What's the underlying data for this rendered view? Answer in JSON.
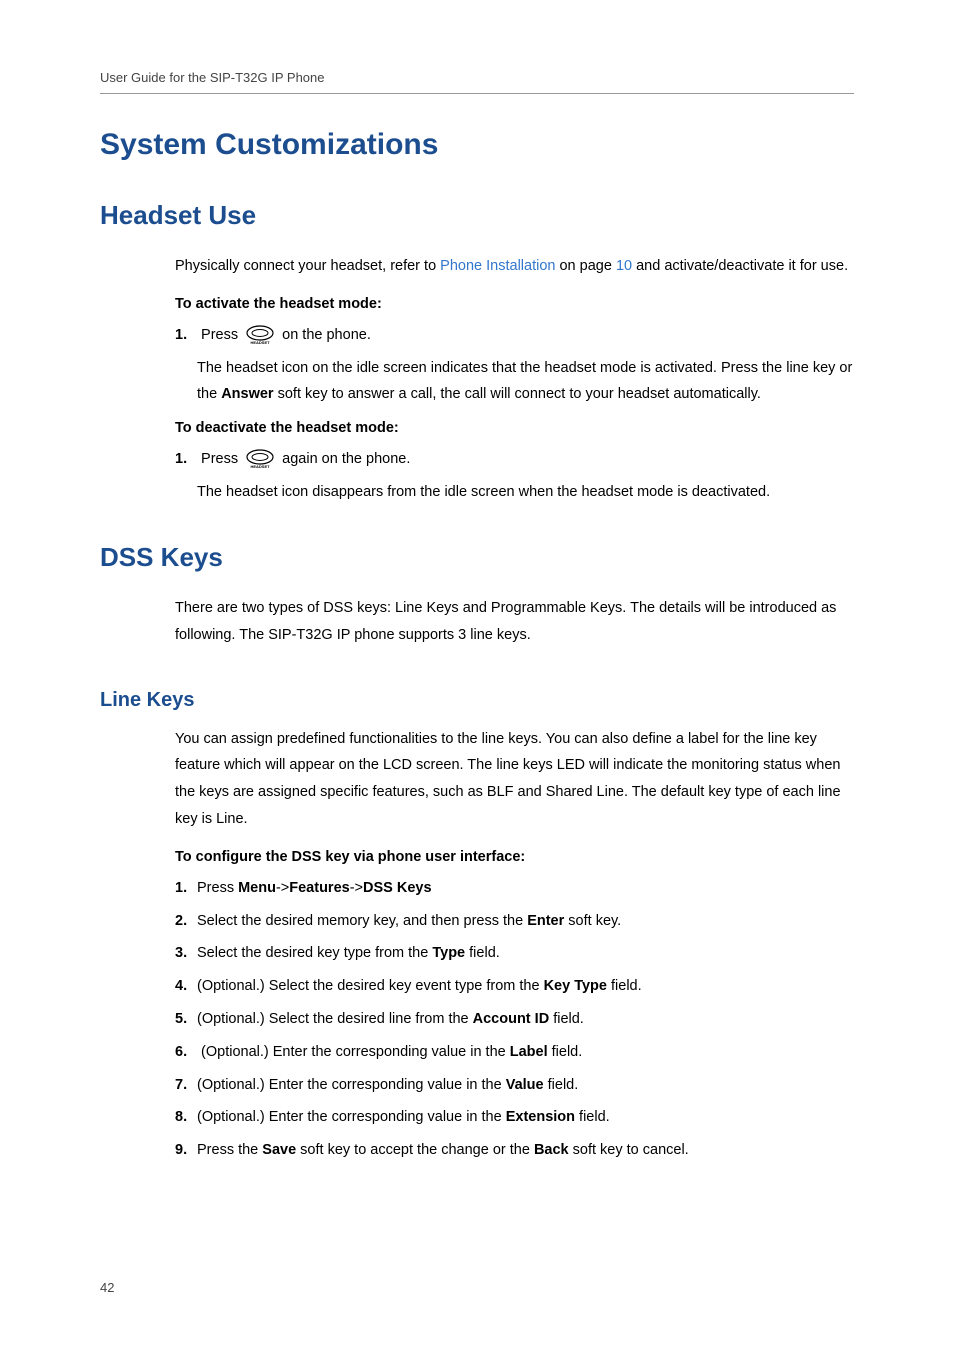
{
  "header": "User Guide for the SIP-T32G IP Phone",
  "pageNumber": "42",
  "h1": "System Customizations",
  "h2_headset": "Headset Use",
  "headset_intro_p1": "Physically connect your headset, refer to ",
  "headset_intro_link": "Phone Installation",
  "headset_intro_p2": " on page ",
  "headset_intro_page": "10",
  "headset_intro_p3": " and activate/deactivate it for use.",
  "activate_subhead": "To activate the headset mode:",
  "activate_step1_num": "1.",
  "activate_step1_a": "Press ",
  "activate_step1_b": " on the phone.",
  "activate_result_a": "The headset icon on the idle screen indicates that the headset mode is activated. Press the line key or the ",
  "activate_result_bold": "Answer",
  "activate_result_b": " soft key to answer a call, the call will connect to your headset automatically.",
  "deactivate_subhead": "To deactivate the headset mode:",
  "deactivate_step1_num": "1.",
  "deactivate_step1_a": "Press ",
  "deactivate_step1_b": " again on the phone.",
  "deactivate_result": "The headset icon disappears from the idle screen when the headset mode is deactivated.",
  "h2_dss": "DSS Keys",
  "dss_intro": "There are two types of DSS keys: Line Keys and Programmable Keys. The details will be introduced as following. The SIP-T32G IP phone supports 3 line keys.",
  "h3_linekeys": "Line Keys",
  "linekeys_intro": "You can assign predefined functionalities to the line keys. You can also define a label for the line key feature which will appear on the LCD screen. The line keys LED will indicate the monitoring status when the keys are assigned specific features, such as BLF and Shared Line. The default key type of each line key is Line.",
  "configure_subhead": "To configure the DSS key via phone user interface:",
  "steps": [
    {
      "num": "1.",
      "parts": [
        {
          "b": 0,
          "t": "Press "
        },
        {
          "b": 1,
          "t": "Menu"
        },
        {
          "b": 0,
          "t": "->"
        },
        {
          "b": 1,
          "t": "Features"
        },
        {
          "b": 0,
          "t": "->"
        },
        {
          "b": 1,
          "t": "DSS Keys"
        }
      ]
    },
    {
      "num": "2.",
      "parts": [
        {
          "b": 0,
          "t": "Select the desired memory key, and then press the "
        },
        {
          "b": 1,
          "t": "Enter"
        },
        {
          "b": 0,
          "t": " soft key."
        }
      ]
    },
    {
      "num": "3.",
      "parts": [
        {
          "b": 0,
          "t": "Select the desired key type from the "
        },
        {
          "b": 1,
          "t": "Type"
        },
        {
          "b": 0,
          "t": " field."
        }
      ]
    },
    {
      "num": "4.",
      "parts": [
        {
          "b": 0,
          "t": "(Optional.) Select the desired key event type from the "
        },
        {
          "b": 1,
          "t": "Key Type"
        },
        {
          "b": 0,
          "t": " field."
        }
      ]
    },
    {
      "num": "5.",
      "parts": [
        {
          "b": 0,
          "t": "(Optional.) Select the desired line from the "
        },
        {
          "b": 1,
          "t": "Account ID"
        },
        {
          "b": 0,
          "t": " field."
        }
      ]
    },
    {
      "num": "6.",
      "parts": [
        {
          "b": 0,
          "t": " (Optional.) Enter the corresponding value in the "
        },
        {
          "b": 1,
          "t": "Label"
        },
        {
          "b": 0,
          "t": " field."
        }
      ]
    },
    {
      "num": "7.",
      "parts": [
        {
          "b": 0,
          "t": "(Optional.) Enter the corresponding value in the "
        },
        {
          "b": 1,
          "t": "Value"
        },
        {
          "b": 0,
          "t": " field."
        }
      ]
    },
    {
      "num": "8.",
      "parts": [
        {
          "b": 0,
          "t": "(Optional.) Enter the corresponding value in the "
        },
        {
          "b": 1,
          "t": "Extension"
        },
        {
          "b": 0,
          "t": " field."
        }
      ]
    },
    {
      "num": "9.",
      "parts": [
        {
          "b": 0,
          "t": "Press the "
        },
        {
          "b": 1,
          "t": "Save"
        },
        {
          "b": 0,
          "t": " soft key to accept the change or the "
        },
        {
          "b": 1,
          "t": "Back"
        },
        {
          "b": 0,
          "t": " soft key to cancel."
        }
      ]
    }
  ]
}
